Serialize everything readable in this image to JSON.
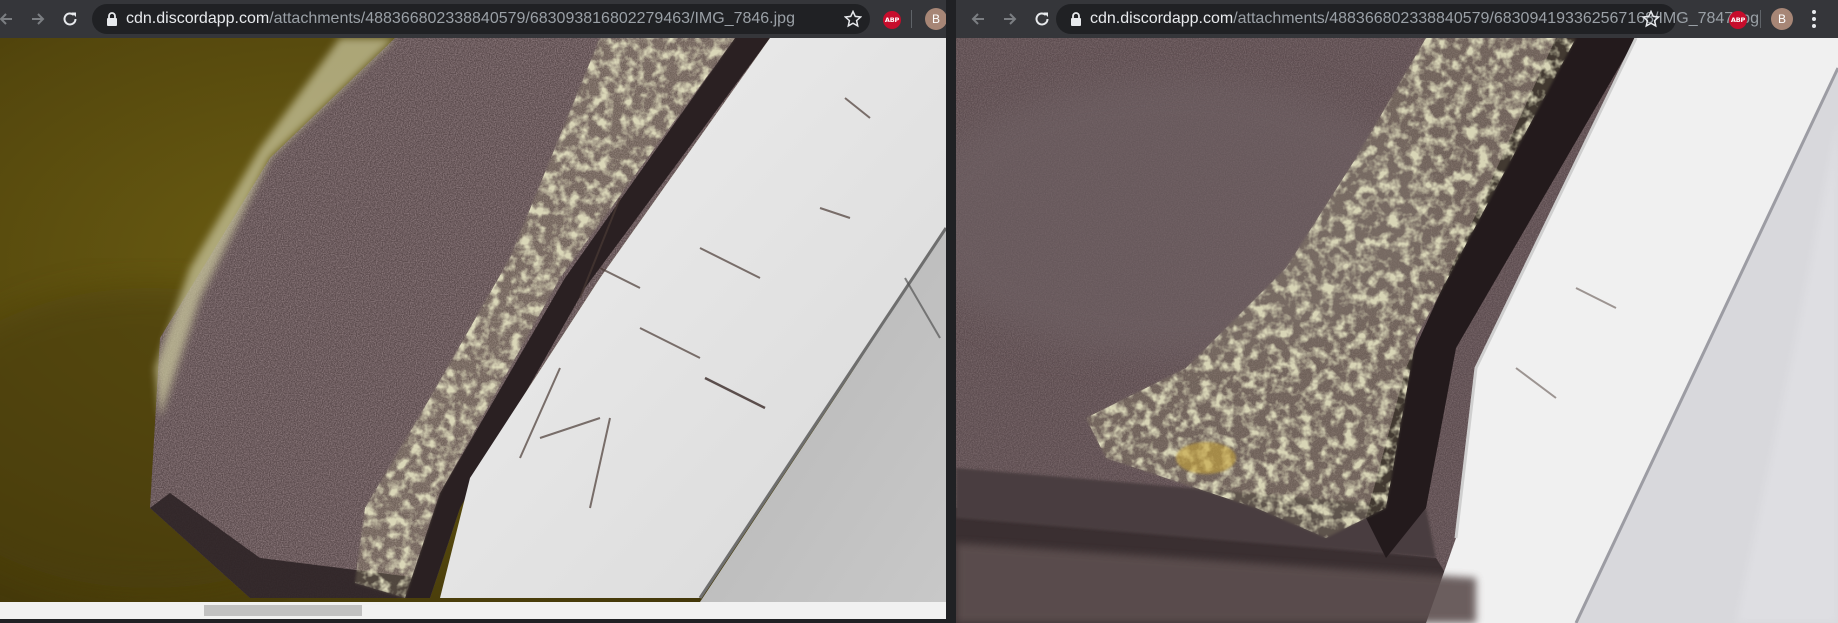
{
  "windows": [
    {
      "url_host": "cdn.discordapp.com",
      "url_path": "/attachments/488366802338840579/683093816802279463/IMG_7846.jpg",
      "image_name": "IMG_7846.jpg",
      "extension_badge": "ABP",
      "profile_initial": "B"
    },
    {
      "url_host": "cdn.discordapp.com",
      "url_path": "/attachments/488366802338840579/683094193362567168/IMG_7847.jpg",
      "image_name": "IMG_7847.jpg",
      "extension_badge": "ABP",
      "profile_initial": "B"
    }
  ],
  "icons": {
    "back": "back-arrow-icon",
    "forward": "forward-arrow-icon",
    "reload": "reload-icon",
    "lock": "lock-icon",
    "bookmark": "star-icon",
    "menu": "kebab-menu-icon"
  },
  "colors": {
    "toolbar": "#35363a",
    "omnibox": "#202124",
    "url_host": "#e8eaed",
    "url_path": "#9aa0a6",
    "abp_red": "#c70d2c",
    "avatar": "#a78676"
  }
}
